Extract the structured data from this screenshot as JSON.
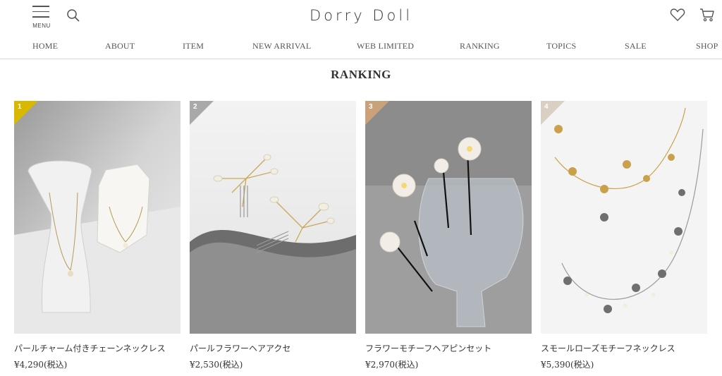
{
  "header": {
    "menu_label": "MENU",
    "logo": "Dorry Doll"
  },
  "nav": {
    "items": [
      {
        "label": "HOME"
      },
      {
        "label": "ABOUT"
      },
      {
        "label": "ITEM"
      },
      {
        "label": "NEW ARRIVAL"
      },
      {
        "label": "WEB LIMITED"
      },
      {
        "label": "RANKING"
      },
      {
        "label": "TOPICS"
      },
      {
        "label": "SALE"
      },
      {
        "label": "SHOP"
      }
    ]
  },
  "section": {
    "title": "RANKING"
  },
  "products": [
    {
      "rank": "1",
      "name": "パールチャーム付きチェーンネックレス",
      "price": "¥4,290(税込)",
      "badge_color": "#d9b800"
    },
    {
      "rank": "2",
      "name": "パールフラワーヘアアクセ",
      "price": "¥2,530(税込)",
      "badge_color": "#a9a9a9"
    },
    {
      "rank": "3",
      "name": "フラワーモチーフヘアピンセット",
      "price": "¥2,970(税込)",
      "badge_color": "#c9a27c"
    },
    {
      "rank": "4",
      "name": "スモールローズモチーフネックレス",
      "price": "¥5,390(税込)",
      "badge_color": "#d9cfc3"
    }
  ],
  "icons": {
    "menu": "hamburger-icon",
    "search": "search-icon",
    "favorite": "heart-icon",
    "cart": "cart-icon"
  }
}
